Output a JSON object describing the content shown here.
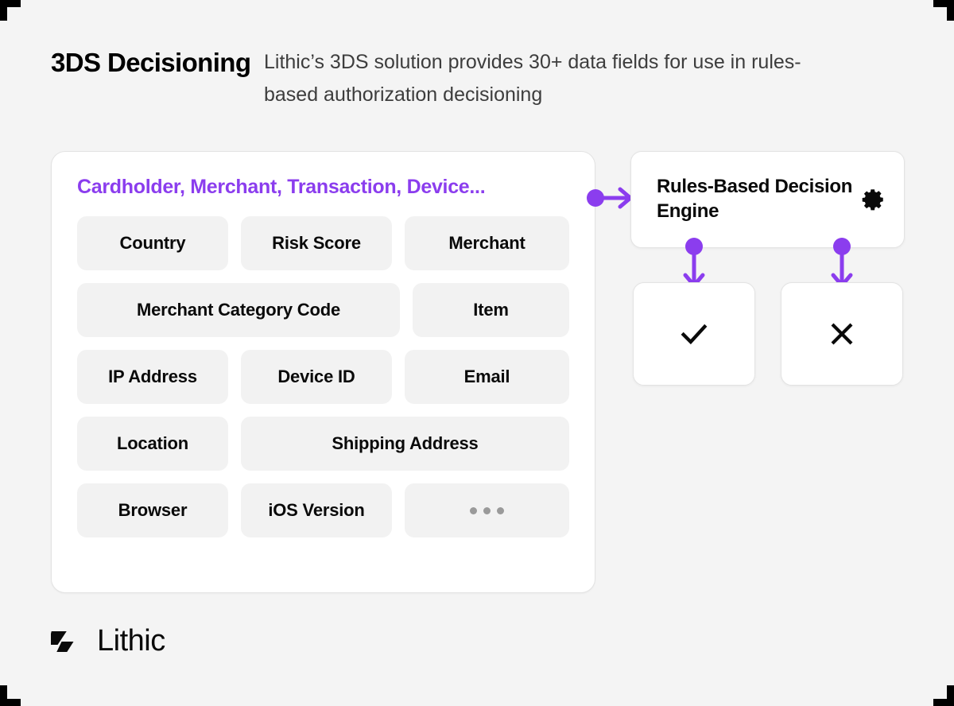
{
  "header": {
    "title": "3DS Decisioning",
    "subtitle": "Lithic’s 3DS solution provides 30+ data fields for use in rules-based authorization decisioning"
  },
  "fields_card": {
    "heading": "Cardholder, Merchant, Transaction, Device...",
    "rows": [
      [
        {
          "label": "Country",
          "width": "w-sm"
        },
        {
          "label": "Risk Score",
          "width": "w-md"
        },
        {
          "label": "Merchant",
          "width": "w-grow"
        }
      ],
      [
        {
          "label": "Merchant Category Code",
          "width": "w-wide"
        },
        {
          "label": "Item",
          "width": "w-grow"
        }
      ],
      [
        {
          "label": "IP Address",
          "width": "w-sm"
        },
        {
          "label": "Device ID",
          "width": "w-md"
        },
        {
          "label": "Email",
          "width": "w-grow"
        }
      ],
      [
        {
          "label": "Location",
          "width": "w-sm"
        },
        {
          "label": "Shipping Address",
          "width": "w-grow"
        }
      ],
      [
        {
          "label": "Browser",
          "width": "w-sm"
        },
        {
          "label": "iOS Version",
          "width": "w-md"
        },
        {
          "label": "",
          "width": "w-grow",
          "icon": "ellipsis-icon"
        }
      ]
    ]
  },
  "engine": {
    "label": "Rules-Based Decision Engine",
    "icon": "gear-icon"
  },
  "outcomes": [
    {
      "name": "approve",
      "icon": "check-icon"
    },
    {
      "name": "decline",
      "icon": "x-icon"
    }
  ],
  "connectors": {
    "in": "arrow-right-icon",
    "approve": "arrow-down-icon",
    "decline": "arrow-down-icon"
  },
  "logo": {
    "word": "Lithic",
    "mark": "lithic-logo-mark"
  },
  "colors": {
    "background": "#f4f4f4",
    "accent_purple": "#8b3dee",
    "card_white": "#ffffff",
    "chip_gray": "#f2f2f2",
    "text_dark": "#0a0a0a",
    "text_muted": "#3d3d3d",
    "dot_gray": "#9a9a9a",
    "border_gray": "#e3e3e3",
    "crop_mark": "#000000"
  }
}
